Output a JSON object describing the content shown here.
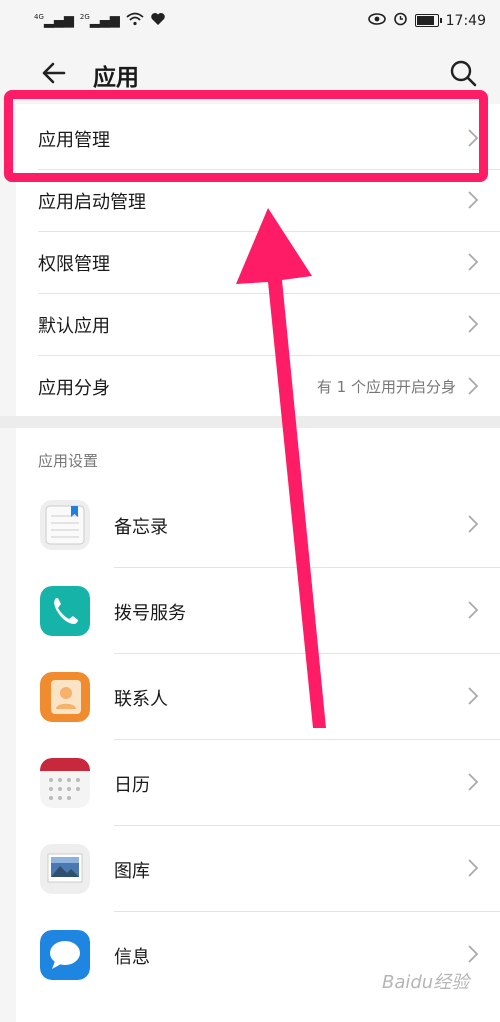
{
  "status_bar": {
    "signal_1": "4G",
    "signal_2": "2G",
    "time": "17:49"
  },
  "header": {
    "title": "应用"
  },
  "menu": [
    {
      "label": "应用管理",
      "value": ""
    },
    {
      "label": "应用启动管理",
      "value": ""
    },
    {
      "label": "权限管理",
      "value": ""
    },
    {
      "label": "默认应用",
      "value": ""
    },
    {
      "label": "应用分身",
      "value": "有 1 个应用开启分身"
    }
  ],
  "section": {
    "title": "应用设置"
  },
  "apps": [
    {
      "label": "备忘录",
      "icon": "notepad-icon"
    },
    {
      "label": "拨号服务",
      "icon": "phone-icon"
    },
    {
      "label": "联系人",
      "icon": "contact-icon"
    },
    {
      "label": "日历",
      "icon": "calendar-icon"
    },
    {
      "label": "图库",
      "icon": "gallery-icon"
    },
    {
      "label": "信息",
      "icon": "message-icon"
    }
  ],
  "annotation": {
    "highlight_color": "#ff1c66"
  },
  "watermark": "Baidu经验"
}
